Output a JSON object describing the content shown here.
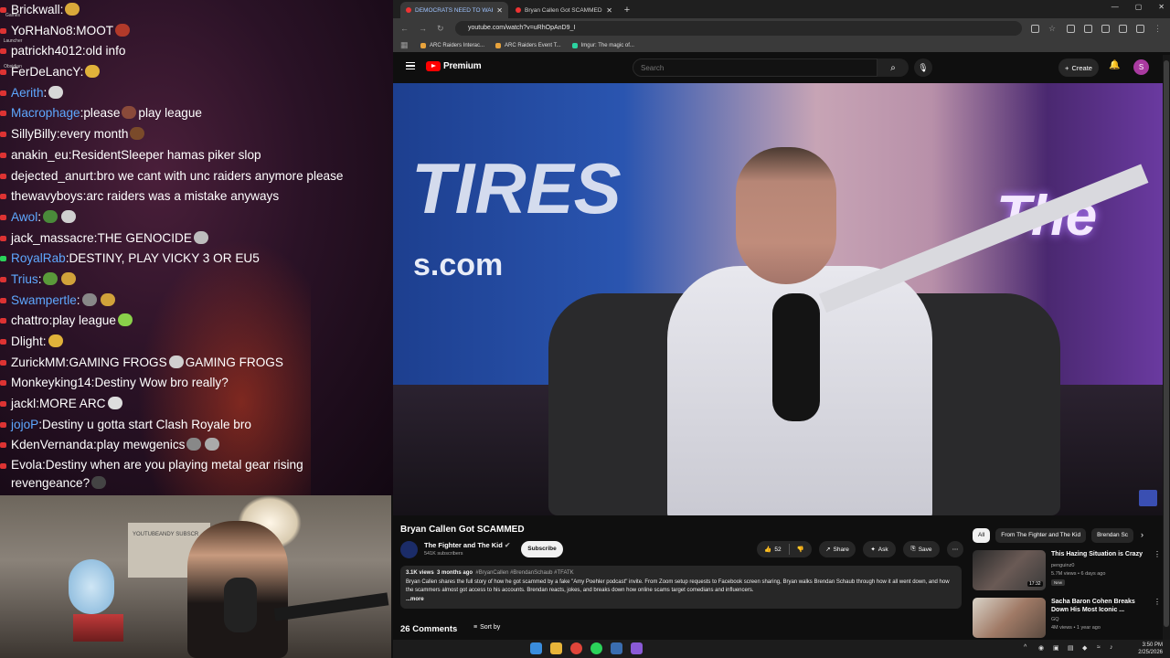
{
  "chat": {
    "lines": [
      {
        "user": "Brickwall",
        "msg": "",
        "color": "white",
        "dot": "red",
        "emotes": [
          "#d9a93a"
        ]
      },
      {
        "user": "YoRHaNo8",
        "msg": "MOOT",
        "color": "white",
        "dot": "red",
        "emotes": [
          "#b23a2a"
        ]
      },
      {
        "user": "patrickh4012",
        "msg": "old info",
        "color": "white",
        "dot": "red",
        "emotes": []
      },
      {
        "user": "FerDeLancY",
        "msg": "",
        "color": "white",
        "dot": "red",
        "emotes": [
          "#e0b23a"
        ]
      },
      {
        "user": "Aerith",
        "msg": "",
        "color": "blue",
        "dot": "red",
        "emotes": [
          "#d7d7d7"
        ]
      },
      {
        "user": "Macrophage",
        "msg": "please",
        "msg2": "play league",
        "color": "blue",
        "dot": "red",
        "emotes": [
          "#8a4a3a"
        ]
      },
      {
        "user": "SillyBilly",
        "msg": "every month",
        "color": "white",
        "dot": "red",
        "emotes": [
          "#7a4a2a"
        ]
      },
      {
        "user": "anakin_eu",
        "msg": "ResidentSleeper hamas piker slop",
        "color": "white",
        "dot": "red",
        "emotes": []
      },
      {
        "user": "dejected_anurt",
        "msg": "bro we cant with unc raiders anymore please",
        "color": "white",
        "dot": "red",
        "emotes": []
      },
      {
        "user": "thewavyboys",
        "msg": "arc raiders was a mistake anyways",
        "color": "white",
        "dot": "red",
        "emotes": []
      },
      {
        "user": "Awol",
        "msg": "",
        "color": "blue",
        "dot": "red",
        "emotes": [
          "#4a8a3a",
          "#cfcfcf"
        ]
      },
      {
        "user": "jack_massacre",
        "msg": "THE GENOCIDE",
        "color": "white",
        "dot": "red",
        "emotes": [
          "#bdbdbd"
        ]
      },
      {
        "user": "RoyalRab",
        "msg": "DESTINY, PLAY VICKY 3 OR EU5",
        "color": "blue",
        "dot": "green",
        "emotes": []
      },
      {
        "user": "Trius",
        "msg": "",
        "color": "blue",
        "dot": "red",
        "emotes": [
          "#5a9a3a",
          "#d0a23a"
        ]
      },
      {
        "user": "Swampertle",
        "msg": "",
        "color": "blue",
        "dot": "red",
        "emotes": [
          "#888888",
          "#d0a23a"
        ]
      },
      {
        "user": "chattro",
        "msg": "play league",
        "color": "white",
        "dot": "red",
        "emotes": [
          "#8ad04a"
        ]
      },
      {
        "user": "Dlight",
        "msg": "",
        "color": "white",
        "dot": "red",
        "emotes": [
          "#e0b23a"
        ]
      },
      {
        "user": "ZurickMM",
        "msg": "GAMING FROGS",
        "msg2": "GAMING FROGS",
        "color": "white",
        "dot": "red",
        "emotes": [
          "#cfcfcf"
        ]
      },
      {
        "user": "Monkeyking14",
        "msg": "Destiny Wow bro really?",
        "color": "white",
        "dot": "red",
        "emotes": []
      },
      {
        "user": "jackl",
        "msg": "MORE ARC",
        "color": "white",
        "dot": "red",
        "emotes": [
          "#dddddd"
        ]
      },
      {
        "user": "jojoP",
        "msg": "Destiny u gotta start Clash Royale bro",
        "color": "blue",
        "dot": "red",
        "emotes": []
      },
      {
        "user": "KdenVernanda",
        "msg": "play mewgenics",
        "color": "white",
        "dot": "red",
        "emotes": [
          "#888888",
          "#aaaaaa"
        ]
      },
      {
        "user": "Evola",
        "msg": "Destiny when are you playing metal gear rising revengeance?",
        "color": "white",
        "dot": "red",
        "emotes": [
          "#444444"
        ],
        "wrap": true
      }
    ],
    "desktop_icons": [
      "Games",
      "Launcher",
      "Obsidian"
    ]
  },
  "webcam": {
    "poster_text": "YOUTUBEANDY SUBSCR"
  },
  "browser": {
    "tabs": [
      {
        "title": "DEMOCRATS NEED TO WAKE",
        "active": true
      },
      {
        "title": "Bryan Callen Got SCAMMED -",
        "active": false
      }
    ],
    "url": "youtube.com/watch?v=uRhOpAnD9_I",
    "bookmarks": [
      "ARC Raiders Interac...",
      "ARC Raiders Event T...",
      "Imgur: The magic of..."
    ]
  },
  "youtube": {
    "logo_text": "Premium",
    "search_placeholder": "Search",
    "create_label": "Create",
    "avatar_letter": "S",
    "video": {
      "banner_text": "TIRES",
      "banner_sub": "s.com",
      "neon_text": "The"
    },
    "title": "Bryan Callen Got SCAMMED",
    "channel": "The Fighter and The Kid",
    "subscribers": "541K subscribers",
    "subscribe_label": "Subscribe",
    "likes": "52",
    "share_label": "Share",
    "ask_label": "Ask",
    "save_label": "Save",
    "description": {
      "views": "3.1K views",
      "age": "3 months ago",
      "tags": "#BryanCallen #BrendanSchaub #TFATK",
      "text": "Bryan Callen shares the full story of how he got scammed by a fake \"Amy Poehler podcast\" invite. From Zoom setup requests to Facebook screen sharing, Bryan walks Brendan Schaub through how it all went down, and how the scammers almost got access to his accounts. Brendan reacts, jokes, and breaks down how online scams target comedians and influencers.",
      "more": "...more"
    },
    "comments_count": "26 Comments",
    "sort_label": "Sort by",
    "chips": [
      "All",
      "From The Fighter and The Kid",
      "Brendan Sc"
    ],
    "recommendations": [
      {
        "title": "This Hazing Situation is Crazy",
        "channel": "penguinz0",
        "meta": "5.7M views • 6 days ago",
        "badge": "New",
        "duration": "17:32",
        "thumb": "#6a5a55"
      },
      {
        "title": "Sacha Baron Cohen Breaks Down His Most Iconic ...",
        "channel": "GQ",
        "meta": "4M views • 1 year ago",
        "badge": "",
        "duration": "",
        "thumb": "#a07a66"
      }
    ]
  },
  "taskbar": {
    "time": "3:50 PM",
    "date": "2/25/2026"
  }
}
